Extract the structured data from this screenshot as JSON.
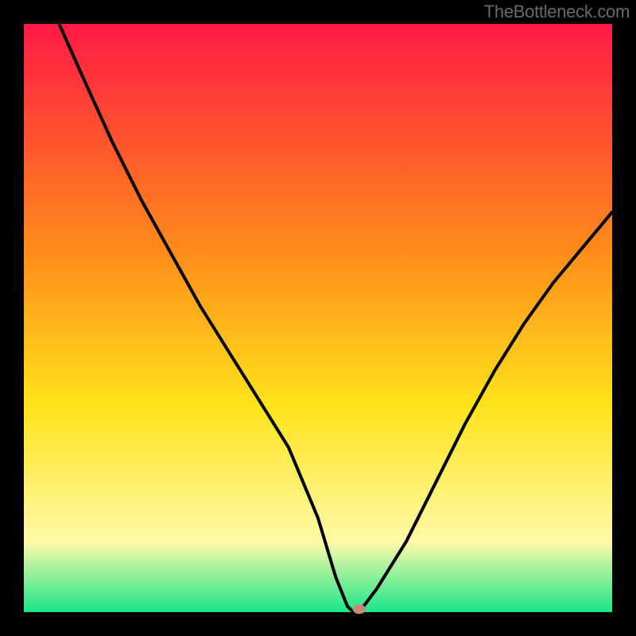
{
  "watermark": "TheBottleneck.com",
  "chart_data": {
    "type": "line",
    "title": "",
    "xlabel": "",
    "ylabel": "",
    "xlim": [
      0,
      100
    ],
    "ylim": [
      0,
      100
    ],
    "background_gradient": {
      "top": "#ff1a45",
      "mid_upper": "#ff8a1a",
      "mid": "#ffe31a",
      "mid_lower": "#fff9a8",
      "bottom": "#1ae68a"
    },
    "border_color": "#000000",
    "border_width": 30,
    "series": [
      {
        "name": "bottleneck-curve",
        "stroke": "#000000",
        "x": [
          6,
          10,
          15,
          20,
          25,
          30,
          35,
          40,
          45,
          50,
          53,
          55,
          56,
          57,
          60,
          65,
          70,
          75,
          80,
          85,
          90,
          95,
          100
        ],
        "values": [
          100,
          91,
          80,
          70,
          61,
          52,
          44,
          36,
          28,
          16,
          6,
          1,
          0,
          0,
          4,
          12,
          22,
          32,
          41,
          49,
          56,
          62,
          68
        ]
      }
    ],
    "marker": {
      "name": "optimal-point",
      "x": 57,
      "y": 0.5,
      "color": "#cc8877"
    }
  }
}
